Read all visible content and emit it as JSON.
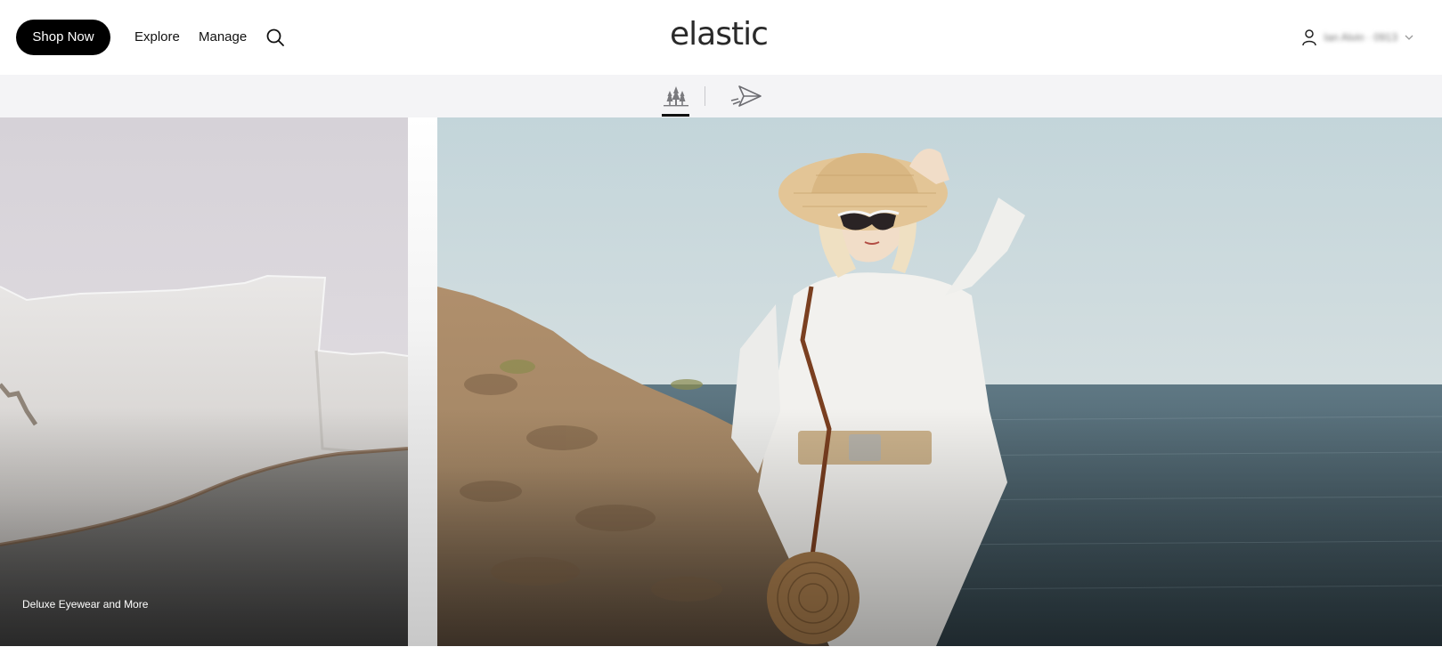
{
  "header": {
    "shop_button": "Shop Now",
    "nav": [
      "Explore",
      "Manage"
    ],
    "logo": "elastic",
    "account_name": "Ian Alvin · 0913"
  },
  "brands": {
    "active_index": 0,
    "icons": [
      "trees-logo-icon",
      "paper-plane-logo-icon"
    ]
  },
  "hero": {
    "left_caption": "Deluxe Eyewear and More"
  },
  "colors": {
    "primary": "#000000",
    "strip_bg": "#f4f4f6",
    "sky": "#c9d7dc",
    "sea": "#3d5560",
    "rock": "#a98662"
  }
}
